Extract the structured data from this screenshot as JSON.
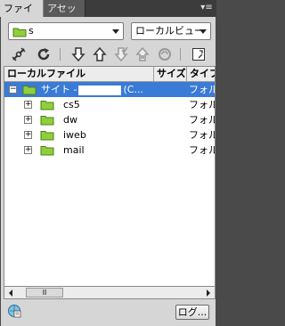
{
  "tabs": [
    {
      "label": "ファイル",
      "active": true
    },
    {
      "label": "アセット",
      "active": false
    }
  ],
  "panel_menu_icon": "options-menu-icon",
  "site_dropdown": {
    "prefix": "s",
    "icon": "site-folder-icon"
  },
  "view_dropdown": {
    "value": "ローカルビュー"
  },
  "toolbar_icons": [
    "connect-icon",
    "refresh-icon",
    "get-icon",
    "put-icon",
    "check-out-icon",
    "check-in-icon",
    "sync-icon",
    "expand-icon"
  ],
  "columns": {
    "name": "ローカルファイル",
    "size": "サイズ",
    "type": "タイプ"
  },
  "root": {
    "label": "サイト -",
    "suffix": "(C...",
    "type": "フォルダ"
  },
  "folders": [
    {
      "name": "cs5",
      "type": "フォルダ"
    },
    {
      "name": "dw",
      "type": "フォルダ"
    },
    {
      "name": "iweb",
      "type": "フォルダ"
    },
    {
      "name": "mail",
      "type": "フォルダ"
    }
  ],
  "scrollbar_thumb": "Ⅲ",
  "log_button": "ログ...",
  "colors": {
    "selection": "#3a7bd5",
    "folder": "#8fcf3c",
    "panel_bg": "#d6d6d6"
  }
}
